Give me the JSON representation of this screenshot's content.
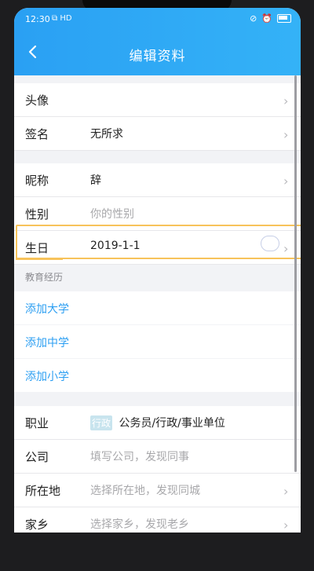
{
  "status": {
    "time": "12:30",
    "signal": "HD"
  },
  "header": {
    "title": "编辑资料"
  },
  "rows": {
    "avatar": {
      "label": "头像"
    },
    "signature": {
      "label": "签名",
      "value": "无所求"
    },
    "nickname": {
      "label": "昵称",
      "value": "辞"
    },
    "gender": {
      "label": "性别",
      "placeholder": "你的性别"
    },
    "birthday": {
      "label": "生日",
      "value": "2019-1-1"
    },
    "education": {
      "section_label": "教育经历"
    },
    "links": {
      "university": "添加大学",
      "middle": "添加中学",
      "primary": "添加小学"
    },
    "job": {
      "label": "职业",
      "badge": "行政",
      "value": "公务员/行政/事业单位"
    },
    "company": {
      "label": "公司",
      "placeholder": "填写公司，发现同事"
    },
    "location": {
      "label": "所在地",
      "placeholder": "选择所在地，发现同城"
    },
    "hometown": {
      "label": "家乡",
      "placeholder": "选择家乡，发现老乡"
    }
  },
  "icons": {
    "back": "chevron-left-icon",
    "chevron": "chevron-right-icon"
  },
  "colors": {
    "header": "#2aa0f3",
    "link": "#2d9ff2",
    "highlight": "#f7c35b"
  }
}
